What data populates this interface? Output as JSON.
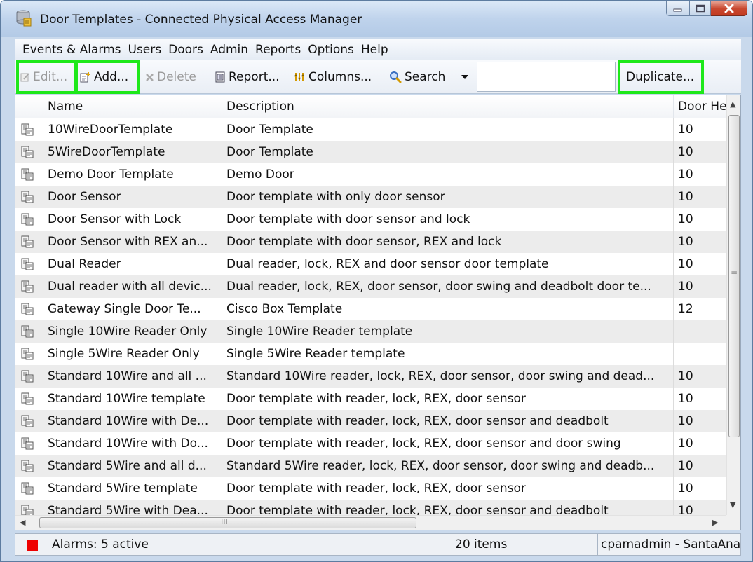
{
  "window": {
    "title": "Door Templates - Connected Physical Access Manager"
  },
  "menu": [
    "Events & Alarms",
    "Users",
    "Doors",
    "Admin",
    "Reports",
    "Options",
    "Help"
  ],
  "toolbar": {
    "edit_label": "Edit...",
    "add_label": "Add...",
    "delete_label": "Delete",
    "report_label": "Report...",
    "columns_label": "Columns...",
    "search_label": "Search",
    "search_value": "",
    "duplicate_label": "Duplicate..."
  },
  "table": {
    "columns": [
      "Name",
      "Description",
      "Door He"
    ],
    "rows": [
      {
        "name": "10WireDoorTemplate",
        "description": "Door Template",
        "door_held": "10"
      },
      {
        "name": "5WireDoorTemplate",
        "description": "Door Template",
        "door_held": "10"
      },
      {
        "name": "Demo Door Template",
        "description": "Demo Door",
        "door_held": "10"
      },
      {
        "name": "Door Sensor",
        "description": "Door template with only door sensor",
        "door_held": "10"
      },
      {
        "name": "Door Sensor with Lock",
        "description": "Door template with door sensor and lock",
        "door_held": "10"
      },
      {
        "name": "Door Sensor with REX an...",
        "description": "Door template with door sensor, REX and lock",
        "door_held": "10"
      },
      {
        "name": "Dual Reader",
        "description": "Dual reader, lock, REX and door sensor door template",
        "door_held": "10"
      },
      {
        "name": "Dual reader with all devic...",
        "description": "Dual reader, lock, REX, door sensor, door swing and deadbolt door te...",
        "door_held": "10"
      },
      {
        "name": "Gateway Single Door Te...",
        "description": "Cisco Box Template",
        "door_held": "12"
      },
      {
        "name": "Single 10Wire Reader Only",
        "description": "Single 10Wire Reader template",
        "door_held": ""
      },
      {
        "name": "Single 5Wire Reader Only",
        "description": "Single 5Wire Reader template",
        "door_held": ""
      },
      {
        "name": "Standard 10Wire and all ...",
        "description": "Standard 10Wire reader, lock, REX, door sensor, door swing and dead...",
        "door_held": "10"
      },
      {
        "name": "Standard 10Wire template",
        "description": "Door template with reader, lock, REX, door sensor",
        "door_held": "10"
      },
      {
        "name": "Standard 10Wire with De...",
        "description": "Door template with reader, lock, REX, door sensor and deadbolt",
        "door_held": "10"
      },
      {
        "name": "Standard 10Wire with Do...",
        "description": "Door template with reader, lock, REX, door sensor and door swing",
        "door_held": "10"
      },
      {
        "name": "Standard 5Wire and all d...",
        "description": "Standard 5Wire reader, lock, REX, door sensor, door swing and deadb...",
        "door_held": "10"
      },
      {
        "name": "Standard 5Wire template",
        "description": "Door template with reader, lock, REX, door sensor",
        "door_held": "10"
      },
      {
        "name": "Standard 5Wire with Dea...",
        "description": "Door template with reader, lock, REX, door sensor and deadbolt",
        "door_held": "10"
      }
    ]
  },
  "scrollbar": {
    "h_grip": "III",
    "v_grip": "≡"
  },
  "status": {
    "alarms": "Alarms: 5 active",
    "items": "20 items",
    "user": "cpamadmin - SantaAna"
  },
  "colors": {
    "highlight": "#1ee81a",
    "alarm": "#ee0000",
    "alt_row": "#ececec"
  }
}
